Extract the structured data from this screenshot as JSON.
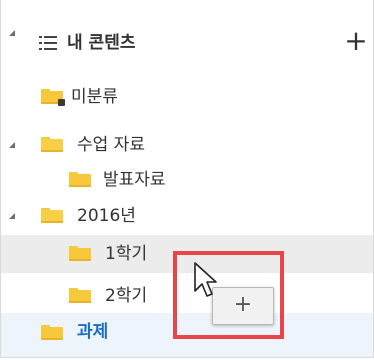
{
  "tree": {
    "root_label": "내 콘텐츠",
    "add_label": "+",
    "items": [
      {
        "label": "미분류"
      },
      {
        "label": "수업 자료"
      },
      {
        "label": "발표자료"
      },
      {
        "label": "2016년"
      },
      {
        "label": "1학기"
      },
      {
        "label": "2학기"
      },
      {
        "label": "과제"
      }
    ]
  },
  "drag": {
    "tooltip": "+"
  },
  "colors": {
    "folder": "#f7c93a",
    "highlight": "#e8474a",
    "active_text": "#1b6cc9",
    "selected_row": "#ececec"
  }
}
